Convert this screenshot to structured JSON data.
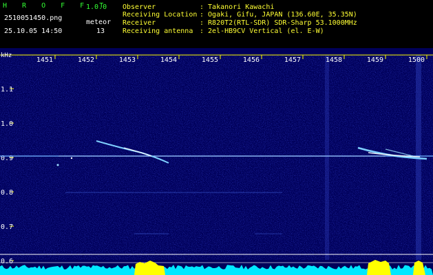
{
  "app": {
    "title": "H R O F F T",
    "version": "1.0.0"
  },
  "file": {
    "name": "2510051450.png",
    "datetime": "25.10.05 14:50"
  },
  "counter": {
    "label": "meteor",
    "value": "13"
  },
  "station": {
    "observer_label": "Observer",
    "observer_value": ": Takanori Kawachi",
    "location_label": "Receiving Location",
    "location_value": ": Ogaki, Gifu, JAPAN (136.60E, 35.35N)",
    "receiver_label": "Receiver",
    "receiver_value": ": R820T2(RTL-SDR) SDR-Sharp 53.1000MHz",
    "antenna_label": "Receiving antenna",
    "antenna_value": ": 2el-HB9CV Vertical (el. E-W)"
  },
  "spectrogram": {
    "unit": "kHz",
    "time_labels": [
      "1451",
      "1452",
      "1453",
      "1454",
      "1455",
      "1456",
      "1457",
      "1458",
      "1459",
      "1500"
    ],
    "freq_labels": [
      "1.1",
      "1.0",
      "0.9",
      "0.8",
      "0.7",
      "0.6"
    ],
    "colors": {
      "background": "#00005a",
      "tick": "#ffff00",
      "carrier": "#ffffff",
      "level": "#00ffff",
      "peak": "#ffff00"
    }
  }
}
